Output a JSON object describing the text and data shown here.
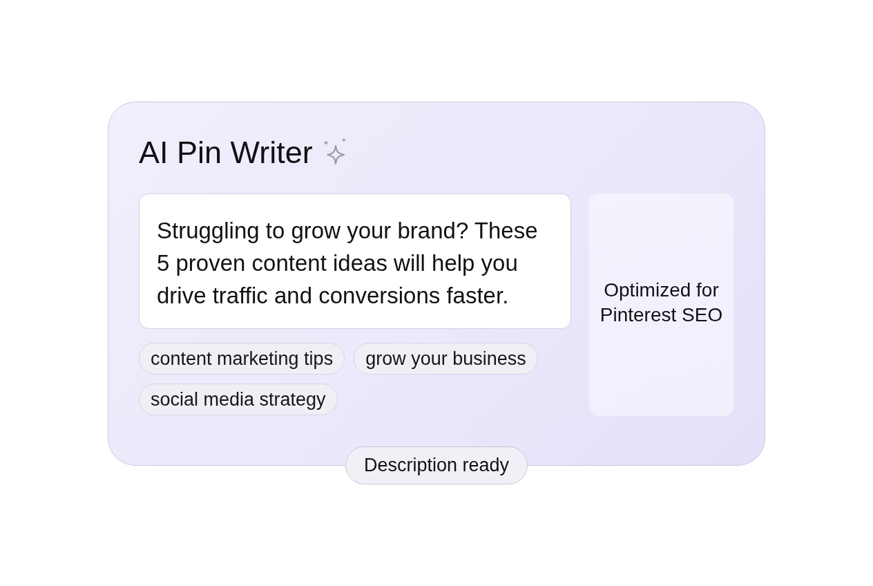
{
  "card": {
    "title": "AI Pin Writer",
    "description": "Struggling to grow your brand? These 5 proven content ideas will help you drive traffic and conversions faster.",
    "tags": [
      "content marketing tips",
      "grow your business",
      "social media strategy"
    ],
    "side_panel": {
      "text": "Optimized for Pinterest SEO"
    }
  },
  "status_badge": "Description ready"
}
